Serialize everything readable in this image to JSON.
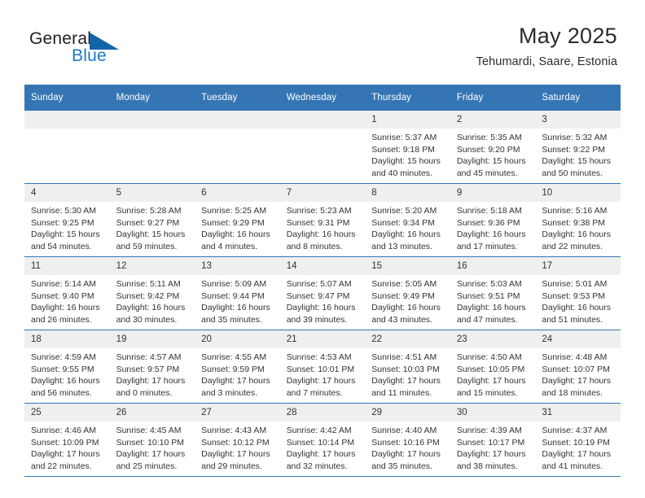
{
  "brand": {
    "name_part1": "General",
    "name_part2": "Blue",
    "accent_color": "#1065a8",
    "blue_text_color": "#1b78c2"
  },
  "header": {
    "title": "May 2025",
    "subtitle": "Tehumardi, Saare, Estonia"
  },
  "calendar": {
    "header_bg": "#3575b4",
    "daynum_bg": "#efefef",
    "weekdays": [
      "Sunday",
      "Monday",
      "Tuesday",
      "Wednesday",
      "Thursday",
      "Friday",
      "Saturday"
    ],
    "weeks": [
      [
        {
          "day": "",
          "empty": true,
          "sunrise": "",
          "sunset": "",
          "daylight1": "",
          "daylight2": ""
        },
        {
          "day": "",
          "empty": true,
          "sunrise": "",
          "sunset": "",
          "daylight1": "",
          "daylight2": ""
        },
        {
          "day": "",
          "empty": true,
          "sunrise": "",
          "sunset": "",
          "daylight1": "",
          "daylight2": ""
        },
        {
          "day": "",
          "empty": true,
          "sunrise": "",
          "sunset": "",
          "daylight1": "",
          "daylight2": ""
        },
        {
          "day": "1",
          "empty": false,
          "sunrise": "Sunrise: 5:37 AM",
          "sunset": "Sunset: 9:18 PM",
          "daylight1": "Daylight: 15 hours",
          "daylight2": "and 40 minutes."
        },
        {
          "day": "2",
          "empty": false,
          "sunrise": "Sunrise: 5:35 AM",
          "sunset": "Sunset: 9:20 PM",
          "daylight1": "Daylight: 15 hours",
          "daylight2": "and 45 minutes."
        },
        {
          "day": "3",
          "empty": false,
          "sunrise": "Sunrise: 5:32 AM",
          "sunset": "Sunset: 9:22 PM",
          "daylight1": "Daylight: 15 hours",
          "daylight2": "and 50 minutes."
        }
      ],
      [
        {
          "day": "4",
          "empty": false,
          "sunrise": "Sunrise: 5:30 AM",
          "sunset": "Sunset: 9:25 PM",
          "daylight1": "Daylight: 15 hours",
          "daylight2": "and 54 minutes."
        },
        {
          "day": "5",
          "empty": false,
          "sunrise": "Sunrise: 5:28 AM",
          "sunset": "Sunset: 9:27 PM",
          "daylight1": "Daylight: 15 hours",
          "daylight2": "and 59 minutes."
        },
        {
          "day": "6",
          "empty": false,
          "sunrise": "Sunrise: 5:25 AM",
          "sunset": "Sunset: 9:29 PM",
          "daylight1": "Daylight: 16 hours",
          "daylight2": "and 4 minutes."
        },
        {
          "day": "7",
          "empty": false,
          "sunrise": "Sunrise: 5:23 AM",
          "sunset": "Sunset: 9:31 PM",
          "daylight1": "Daylight: 16 hours",
          "daylight2": "and 8 minutes."
        },
        {
          "day": "8",
          "empty": false,
          "sunrise": "Sunrise: 5:20 AM",
          "sunset": "Sunset: 9:34 PM",
          "daylight1": "Daylight: 16 hours",
          "daylight2": "and 13 minutes."
        },
        {
          "day": "9",
          "empty": false,
          "sunrise": "Sunrise: 5:18 AM",
          "sunset": "Sunset: 9:36 PM",
          "daylight1": "Daylight: 16 hours",
          "daylight2": "and 17 minutes."
        },
        {
          "day": "10",
          "empty": false,
          "sunrise": "Sunrise: 5:16 AM",
          "sunset": "Sunset: 9:38 PM",
          "daylight1": "Daylight: 16 hours",
          "daylight2": "and 22 minutes."
        }
      ],
      [
        {
          "day": "11",
          "empty": false,
          "sunrise": "Sunrise: 5:14 AM",
          "sunset": "Sunset: 9:40 PM",
          "daylight1": "Daylight: 16 hours",
          "daylight2": "and 26 minutes."
        },
        {
          "day": "12",
          "empty": false,
          "sunrise": "Sunrise: 5:11 AM",
          "sunset": "Sunset: 9:42 PM",
          "daylight1": "Daylight: 16 hours",
          "daylight2": "and 30 minutes."
        },
        {
          "day": "13",
          "empty": false,
          "sunrise": "Sunrise: 5:09 AM",
          "sunset": "Sunset: 9:44 PM",
          "daylight1": "Daylight: 16 hours",
          "daylight2": "and 35 minutes."
        },
        {
          "day": "14",
          "empty": false,
          "sunrise": "Sunrise: 5:07 AM",
          "sunset": "Sunset: 9:47 PM",
          "daylight1": "Daylight: 16 hours",
          "daylight2": "and 39 minutes."
        },
        {
          "day": "15",
          "empty": false,
          "sunrise": "Sunrise: 5:05 AM",
          "sunset": "Sunset: 9:49 PM",
          "daylight1": "Daylight: 16 hours",
          "daylight2": "and 43 minutes."
        },
        {
          "day": "16",
          "empty": false,
          "sunrise": "Sunrise: 5:03 AM",
          "sunset": "Sunset: 9:51 PM",
          "daylight1": "Daylight: 16 hours",
          "daylight2": "and 47 minutes."
        },
        {
          "day": "17",
          "empty": false,
          "sunrise": "Sunrise: 5:01 AM",
          "sunset": "Sunset: 9:53 PM",
          "daylight1": "Daylight: 16 hours",
          "daylight2": "and 51 minutes."
        }
      ],
      [
        {
          "day": "18",
          "empty": false,
          "sunrise": "Sunrise: 4:59 AM",
          "sunset": "Sunset: 9:55 PM",
          "daylight1": "Daylight: 16 hours",
          "daylight2": "and 56 minutes."
        },
        {
          "day": "19",
          "empty": false,
          "sunrise": "Sunrise: 4:57 AM",
          "sunset": "Sunset: 9:57 PM",
          "daylight1": "Daylight: 17 hours",
          "daylight2": "and 0 minutes."
        },
        {
          "day": "20",
          "empty": false,
          "sunrise": "Sunrise: 4:55 AM",
          "sunset": "Sunset: 9:59 PM",
          "daylight1": "Daylight: 17 hours",
          "daylight2": "and 3 minutes."
        },
        {
          "day": "21",
          "empty": false,
          "sunrise": "Sunrise: 4:53 AM",
          "sunset": "Sunset: 10:01 PM",
          "daylight1": "Daylight: 17 hours",
          "daylight2": "and 7 minutes."
        },
        {
          "day": "22",
          "empty": false,
          "sunrise": "Sunrise: 4:51 AM",
          "sunset": "Sunset: 10:03 PM",
          "daylight1": "Daylight: 17 hours",
          "daylight2": "and 11 minutes."
        },
        {
          "day": "23",
          "empty": false,
          "sunrise": "Sunrise: 4:50 AM",
          "sunset": "Sunset: 10:05 PM",
          "daylight1": "Daylight: 17 hours",
          "daylight2": "and 15 minutes."
        },
        {
          "day": "24",
          "empty": false,
          "sunrise": "Sunrise: 4:48 AM",
          "sunset": "Sunset: 10:07 PM",
          "daylight1": "Daylight: 17 hours",
          "daylight2": "and 18 minutes."
        }
      ],
      [
        {
          "day": "25",
          "empty": false,
          "sunrise": "Sunrise: 4:46 AM",
          "sunset": "Sunset: 10:09 PM",
          "daylight1": "Daylight: 17 hours",
          "daylight2": "and 22 minutes."
        },
        {
          "day": "26",
          "empty": false,
          "sunrise": "Sunrise: 4:45 AM",
          "sunset": "Sunset: 10:10 PM",
          "daylight1": "Daylight: 17 hours",
          "daylight2": "and 25 minutes."
        },
        {
          "day": "27",
          "empty": false,
          "sunrise": "Sunrise: 4:43 AM",
          "sunset": "Sunset: 10:12 PM",
          "daylight1": "Daylight: 17 hours",
          "daylight2": "and 29 minutes."
        },
        {
          "day": "28",
          "empty": false,
          "sunrise": "Sunrise: 4:42 AM",
          "sunset": "Sunset: 10:14 PM",
          "daylight1": "Daylight: 17 hours",
          "daylight2": "and 32 minutes."
        },
        {
          "day": "29",
          "empty": false,
          "sunrise": "Sunrise: 4:40 AM",
          "sunset": "Sunset: 10:16 PM",
          "daylight1": "Daylight: 17 hours",
          "daylight2": "and 35 minutes."
        },
        {
          "day": "30",
          "empty": false,
          "sunrise": "Sunrise: 4:39 AM",
          "sunset": "Sunset: 10:17 PM",
          "daylight1": "Daylight: 17 hours",
          "daylight2": "and 38 minutes."
        },
        {
          "day": "31",
          "empty": false,
          "sunrise": "Sunrise: 4:37 AM",
          "sunset": "Sunset: 10:19 PM",
          "daylight1": "Daylight: 17 hours",
          "daylight2": "and 41 minutes."
        }
      ]
    ]
  }
}
